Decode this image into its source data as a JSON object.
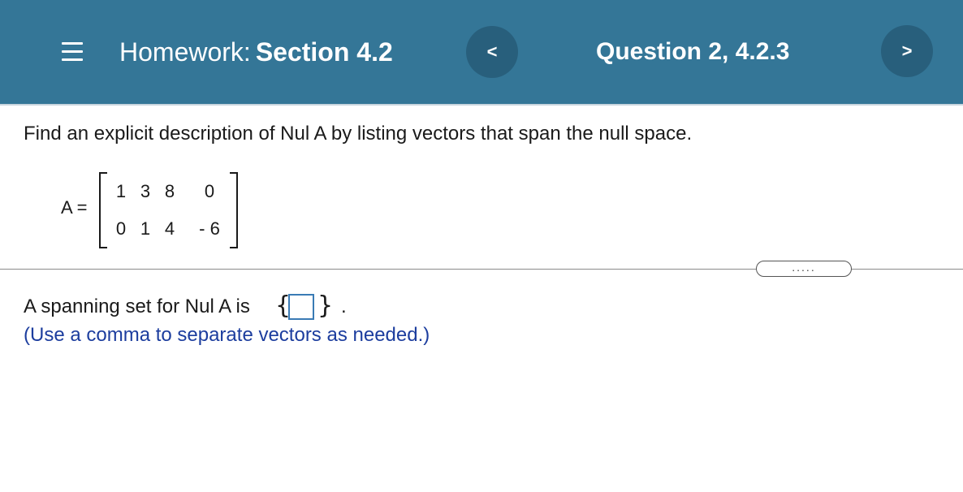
{
  "header": {
    "menu_icon": "hamburger-menu-icon",
    "homework_prefix": "Homework:",
    "section_title": "Section 4.2",
    "prev_label": "<",
    "question_title": "Question 2, 4.2.3",
    "next_label": ">",
    "background_color": "#347697"
  },
  "problem": {
    "prompt": "Find an explicit description of Nul A by listing vectors that span the null space.",
    "matrix_label": "A =",
    "matrix": [
      [
        "1",
        "3",
        "8",
        "0"
      ],
      [
        "0",
        "1",
        "4",
        "- 6"
      ]
    ]
  },
  "expander": {
    "label": "....."
  },
  "answer": {
    "text": "A spanning set for Nul A is",
    "open_brace": "{",
    "close_brace": "}",
    "period": ".",
    "input_value": "",
    "hint": "(Use a comma to separate vectors as needed.)"
  }
}
